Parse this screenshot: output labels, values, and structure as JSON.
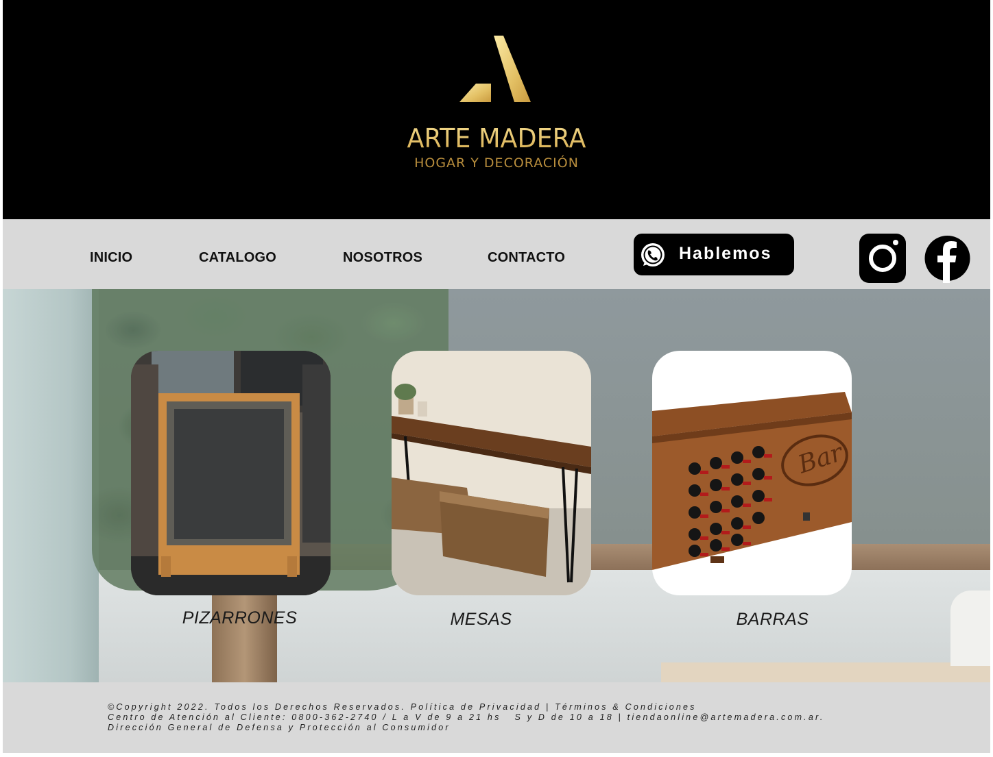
{
  "brand": {
    "name": "ARTE MADERA",
    "tagline": "HOGAR Y DECORACIÓN",
    "gold": "#e0bb62"
  },
  "nav": {
    "items": [
      {
        "label": "INICIO"
      },
      {
        "label": "CATALOGO"
      },
      {
        "label": "NOSOTROS"
      },
      {
        "label": "CONTACTO"
      }
    ],
    "cta_label": "Hablemos",
    "cta_icon": "whatsapp-icon",
    "social": [
      "instagram-icon",
      "facebook-icon"
    ]
  },
  "categories": [
    {
      "label": "PIZARRONES",
      "image": "chalkboard-sign"
    },
    {
      "label": "MESAS",
      "image": "console-table-with-baskets"
    },
    {
      "label": "BARRAS",
      "image": "wooden-bar-with-wine-rack"
    }
  ],
  "footer": {
    "line1": "©Copyright 2022. Todos los Derechos Reservados. Política de Privacidad | Términos & Condiciones",
    "line2": "Centro de Atención al Cliente: 0800-362-2740 / L a V de 9 a 21 hs   S y D de 10 a 18 | tiendaonline@artemadera.com.ar.",
    "line3": "Dirección General de Defensa y Protección al Consumidor"
  }
}
